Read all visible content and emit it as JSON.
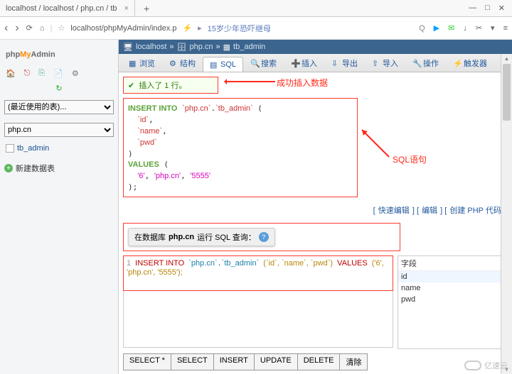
{
  "chrome": {
    "tab_title": "localhost / localhost / php.cn / tb",
    "tab_close": "×",
    "plus": "+",
    "win_min": "—",
    "win_max": "□",
    "win_close": "✕"
  },
  "url": {
    "back": "‹",
    "fwd": "›",
    "reload": "⟳",
    "home": "⌂",
    "star": "☆",
    "address": "localhost/phpMyAdmin/index.p",
    "flash": "⚡",
    "crumb_arrow": "▸",
    "news": "15岁少年恐吓继母",
    "search": "Q",
    "play": "▶",
    "chat": "✉",
    "down": "↓",
    "cut": "✂",
    "ext": "▾",
    "menu": "≡"
  },
  "logo": {
    "a": "php",
    "b": "My",
    "c": "Admin"
  },
  "icons": {
    "home": "🏠",
    "exit": "⎋",
    "sql": "⎘",
    "doc": "📄",
    "gear": "⚙",
    "reload": "↻"
  },
  "selects": {
    "recent": "(最近使用的表)...",
    "db": "php.cn"
  },
  "tree": {
    "table": "tb_admin"
  },
  "newtable": "新建数据表",
  "breadcrumb": {
    "server": "localhost",
    "db": "php.cn",
    "table": "tb_admin",
    "sep": "»"
  },
  "tabs": {
    "browse": "浏览",
    "structure": "结构",
    "sql": "SQL",
    "search": "搜索",
    "insert": "插入",
    "export": "导出",
    "import": "导入",
    "operations": "操作",
    "triggers": "触发器"
  },
  "success": "插入了 1 行。",
  "anno_success": "成功插入数据",
  "sql": {
    "insert": "INSERT INTO",
    "db": "`php.cn`",
    "tbl": "`tb_admin`",
    "c1": "`id`",
    "c2": "`name`",
    "c3": "`pwd`",
    "values": "VALUES",
    "v1": "'6'",
    "v2": "'php.cn'",
    "v3": "'5555'"
  },
  "anno_sql": "SQL语句",
  "links": {
    "quick": "快速编辑",
    "edit": "编辑",
    "create": "创建 PHP 代码"
  },
  "query": {
    "prefix": "在数据库 ",
    "dbname": "php.cn",
    "suffix": " 运行 SQL 查询：",
    "line": "1",
    "text_insert": "INSERT INTO",
    "text_db": "`php.cn`",
    "text_tbl": "`tb_admin`",
    "text_cols": "(`id`, `name`, `pwd`)",
    "text_values": "VALUES",
    "text_vals": "('6', 'php.cn', '5555');"
  },
  "fields": {
    "header": "字段",
    "id": "id",
    "name": "name",
    "pwd": "pwd"
  },
  "buttons": {
    "selectall": "SELECT *",
    "select": "SELECT",
    "insert": "INSERT",
    "update": "UPDATE",
    "delete": "DELETE",
    "clear": "清除"
  },
  "watermark": "亿速云"
}
